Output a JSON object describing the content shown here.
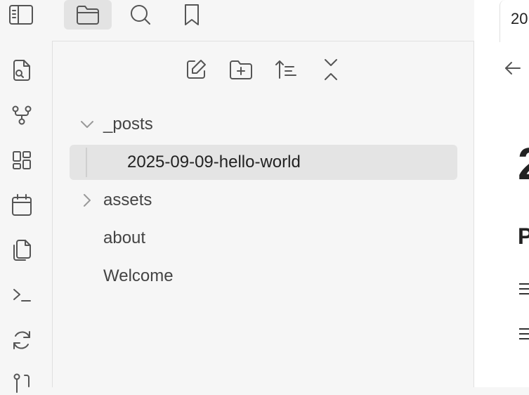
{
  "topbar": {
    "buttons": [
      {
        "name": "sidebar-toggle",
        "icon": "sidebar-toggle-icon"
      },
      {
        "name": "files",
        "icon": "folder-icon",
        "active": true
      },
      {
        "name": "search",
        "icon": "search-icon"
      },
      {
        "name": "bookmarks",
        "icon": "bookmark-icon"
      }
    ]
  },
  "ribbon": {
    "items": [
      {
        "name": "open-quick-switcher",
        "icon": "file-search-icon"
      },
      {
        "name": "open-graph-view",
        "icon": "graph-icon"
      },
      {
        "name": "open-canvas",
        "icon": "layout-dashboard-icon"
      },
      {
        "name": "open-daily-note",
        "icon": "calendar-icon"
      },
      {
        "name": "insert-template",
        "icon": "files-icon"
      },
      {
        "name": "open-command-palette",
        "icon": "terminal-icon"
      },
      {
        "name": "sync",
        "icon": "refresh-icon"
      },
      {
        "name": "git",
        "icon": "git-icon"
      }
    ]
  },
  "explorer": {
    "actions": [
      {
        "name": "new-note",
        "icon": "edit-icon"
      },
      {
        "name": "new-folder",
        "icon": "folder-plus-icon"
      },
      {
        "name": "change-sort-order",
        "icon": "sort-icon"
      },
      {
        "name": "collapse-all",
        "icon": "collapse-icon"
      }
    ],
    "tree": [
      {
        "label": "_posts",
        "type": "folder",
        "expanded": true
      },
      {
        "label": "2025-09-09-hello-world",
        "type": "file",
        "selected": true
      },
      {
        "label": "assets",
        "type": "folder",
        "expanded": false
      },
      {
        "label": "about",
        "type": "file"
      },
      {
        "label": "Welcome",
        "type": "file"
      }
    ]
  },
  "right_pane": {
    "tab_title": "20",
    "heading_fragment": "2",
    "subheading_fragment": "P"
  },
  "colors": {
    "background": "#f6f6f6",
    "selected": "#e4e4e4",
    "active_button": "#e3e3e3",
    "border": "#e0e0e0"
  }
}
